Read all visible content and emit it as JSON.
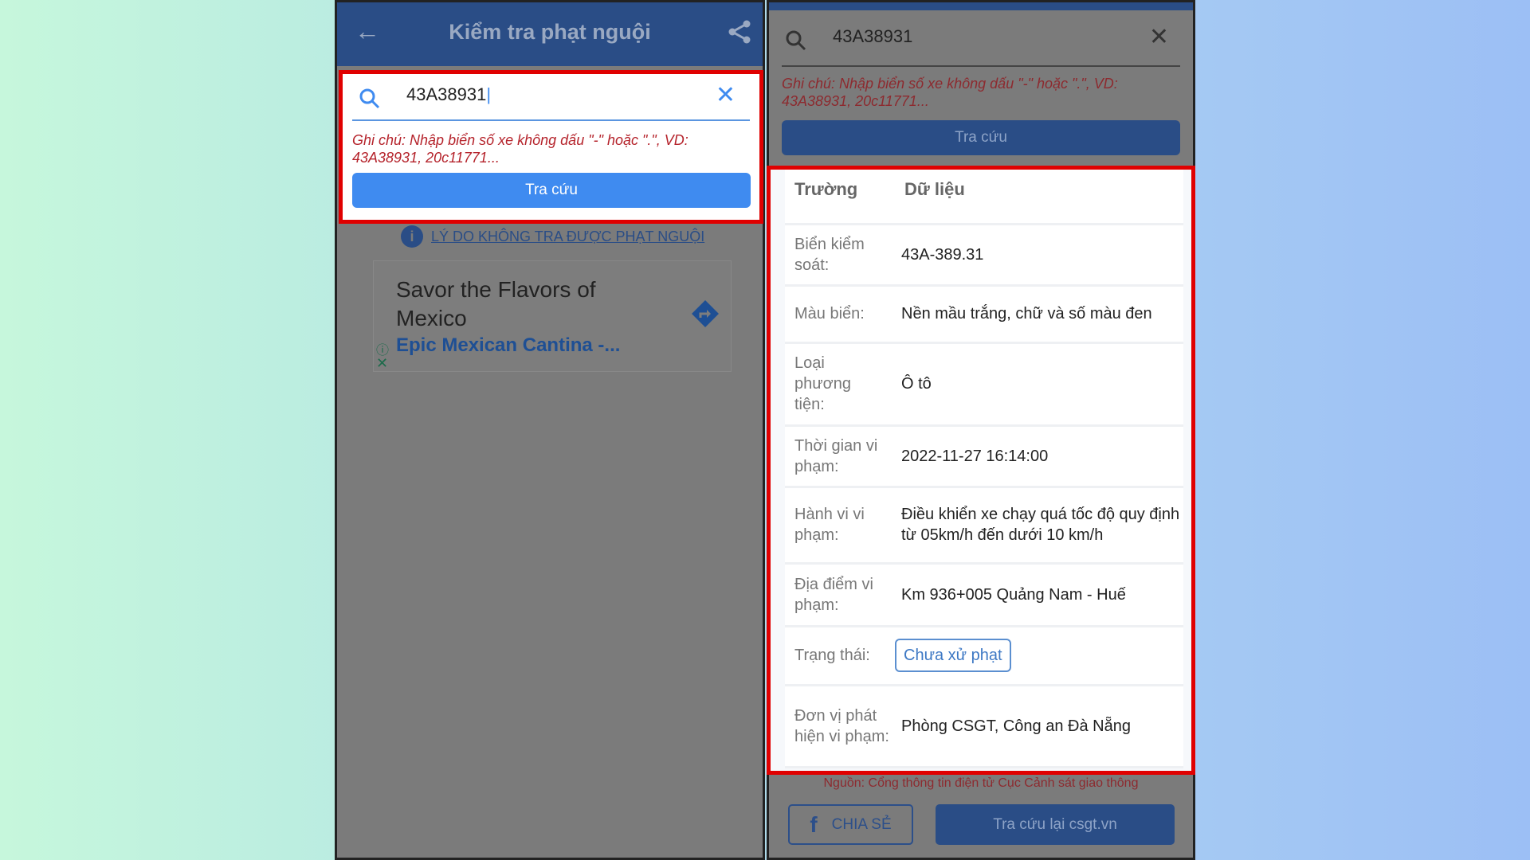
{
  "left_screen": {
    "header": {
      "title": "Kiểm tra phạt nguội",
      "back_icon": "arrow-left-icon",
      "share_icon": "share-icon"
    },
    "search": {
      "value": "43A38931",
      "clear_icon": "close-icon"
    },
    "note": "Ghi chú: Nhập biển số xe không dấu \"-\" hoặc \".\", VD: 43A38931, 20c11771...",
    "search_button": "Tra cứu",
    "reason_link": "LÝ DO KHÔNG TRA ĐƯỢC PHẠT NGUỘI",
    "ad": {
      "headline": "Savor the Flavors of Mexico",
      "advertiser": "Epic Mexican Cantina -..."
    }
  },
  "right_screen": {
    "search": {
      "value": "43A38931"
    },
    "note": "Ghi chú: Nhập biển số xe không dấu \"-\" hoặc \".\", VD: 43A38931, 20c11771...",
    "search_button": "Tra cứu",
    "table": {
      "headers": [
        "Trường",
        "Dữ liệu"
      ],
      "rows": [
        {
          "field": "Biển kiểm soát:",
          "value": "43A-389.31"
        },
        {
          "field": "Màu biển:",
          "value": "Nền mầu trắng, chữ và số màu đen"
        },
        {
          "field": "Loại phương tiện:",
          "value": "Ô tô"
        },
        {
          "field": "Thời gian vi phạm:",
          "value": "2022-11-27 16:14:00"
        },
        {
          "field": "Hành vi vi phạm:",
          "value": "Điều khiển xe chạy quá tốc độ quy định từ 05km/h đến dưới 10 km/h"
        },
        {
          "field": "Địa điểm vi phạm:",
          "value": "Km 936+005 Quảng Nam - Huế"
        },
        {
          "field": "Trạng thái:",
          "value": "Chưa xử phạt"
        },
        {
          "field": "Đơn vị phát hiện vi phạm:",
          "value": "Phòng CSGT, Công an  Đà Nẵng"
        }
      ]
    },
    "source": "Nguồn: Cổng thông tin điện tử Cục Cảnh sát giao thông",
    "share_button": "CHIA SẺ",
    "recheck_button": "Tra cứu lại csgt.vn"
  },
  "colors": {
    "highlight": "#e00000",
    "primary": "#3f8bf0",
    "header": "#2a4d86",
    "note": "#b5232b"
  }
}
